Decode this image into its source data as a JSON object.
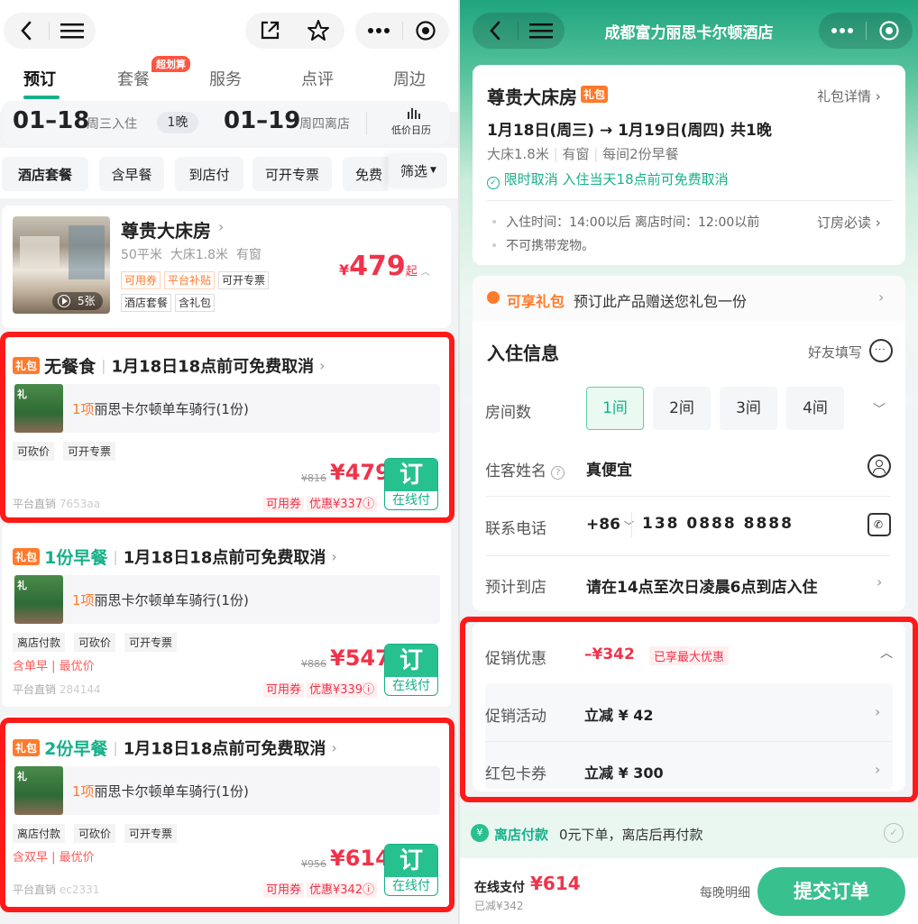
{
  "left": {
    "tabs": [
      "预订",
      "套餐",
      "服务",
      "点评",
      "周边"
    ],
    "hot_badge": "超划算",
    "dates": {
      "checkin_date": "01–18",
      "checkin_label": "周三入住",
      "nights": "1晚",
      "checkout_date": "01–19",
      "checkout_label": "周四离店",
      "calendar": "低价日历"
    },
    "filters": [
      "酒店套餐",
      "含早餐",
      "到店付",
      "可开专票",
      "免费"
    ],
    "filter_dropdown": "筛选",
    "room": {
      "name": "尊贵大床房",
      "area": "50平米",
      "bed": "大床1.8米",
      "window": "有窗",
      "tags_row1": [
        "可用券",
        "平台补贴",
        "可开专票"
      ],
      "tags_row2": [
        "酒店套餐",
        "含礼包"
      ],
      "price": "479",
      "currency": "¥",
      "suffix": "起",
      "photo_count": "5张"
    },
    "packages": [
      {
        "gift_tag": "礼包",
        "meal": "无餐食",
        "meal_color": "#222222",
        "cancel": "1月18日18点前可免费取消",
        "gift_count": "1项",
        "gift_name": "丽思卡尔顿单车骑行(1份)",
        "tags": [
          "可砍价",
          "可开专票"
        ],
        "note": "",
        "old_price": "¥816",
        "price": "¥479",
        "platform": "平台直销",
        "code": "7653aa",
        "coupon": "可用券",
        "discount": "优惠¥337ⓘ",
        "book": "订",
        "pay": "在线付"
      },
      {
        "gift_tag": "礼包",
        "meal": "1份早餐",
        "meal_color": "#16b08a",
        "cancel": "1月18日18点前可免费取消",
        "gift_count": "1项",
        "gift_name": "丽思卡尔顿单车骑行(1份)",
        "tags": [
          "离店付款",
          "可砍价",
          "可开专票"
        ],
        "note": "含单早 | 最优价",
        "old_price": "¥886",
        "price": "¥547",
        "platform": "平台直销",
        "code": "284144",
        "coupon": "可用券",
        "discount": "优惠¥339ⓘ",
        "book": "订",
        "pay": "在线付"
      },
      {
        "gift_tag": "礼包",
        "meal": "2份早餐",
        "meal_color": "#16b08a",
        "cancel": "1月18日18点前可免费取消",
        "gift_count": "1项",
        "gift_name": "丽思卡尔顿单车骑行(1份)",
        "tags": [
          "离店付款",
          "可砍价",
          "可开专票"
        ],
        "note": "含双早 | 最优价",
        "old_price": "¥956",
        "price": "¥614",
        "platform": "平台直销",
        "code": "ec2331",
        "coupon": "可用券",
        "discount": "优惠¥342ⓘ",
        "book": "订",
        "pay": "在线付"
      }
    ]
  },
  "right": {
    "title": "成都富力丽思卡尔顿酒店",
    "summary": {
      "room": "尊贵大床房",
      "gift_tag": "礼包",
      "gift_detail": "礼包详情",
      "dates": "1月18日(周三) → 1月19日(周四) 共1晚",
      "features": [
        "大床1.8米",
        "有窗",
        "每间2份早餐"
      ],
      "cancel": "限时取消  入住当天18点前可免费取消",
      "checkin": "入住时间：14:00以后  离店时间：12:00以前",
      "must_read": "订房必读",
      "pets": "不可携带宠物。"
    },
    "gift_banner": {
      "title": "可享礼包",
      "text": "预订此产品赠送您礼包一份"
    },
    "checkin_info": {
      "heading": "入住信息",
      "friend_fill": "好友填写",
      "rooms_label": "房间数",
      "room_options": [
        "1间",
        "2间",
        "3间",
        "4间"
      ],
      "guest_label": "住客姓名",
      "guest_value": "真便宜",
      "phone_label": "联系电话",
      "country_code": "+86",
      "phone_value": "138 0888 8888",
      "arrival_label": "预计到店",
      "arrival_value": "请在14点至次日凌晨6点到店入住"
    },
    "promo": {
      "label": "促销优惠",
      "amount": "–¥342",
      "max_badge": "已享最大优惠",
      "activity_label": "促销活动",
      "activity_value": "立减 ¥ 42",
      "coupon_label": "红包卡券",
      "coupon_value": "立减 ¥ 300"
    },
    "pay_later": {
      "label": "离店付款",
      "text": "0元下单，离店后再付款"
    },
    "footer": {
      "online_pay": "在线支付",
      "price": "¥614",
      "saved": "已减¥342",
      "nightly": "每晚明细",
      "submit": "提交订单"
    }
  }
}
